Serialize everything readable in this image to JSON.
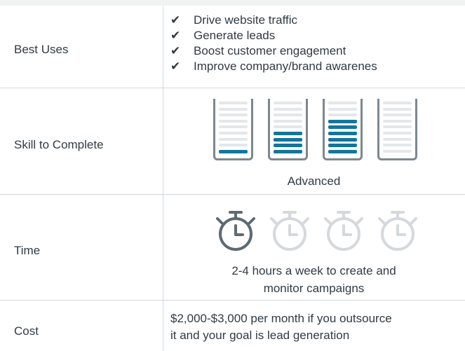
{
  "rows": {
    "best_uses": {
      "label": "Best Uses",
      "items": [
        "Drive website traffic",
        "Generate leads",
        "Boost customer engagement",
        "Improve company/brand awarenes"
      ]
    },
    "skill": {
      "label": "Skill to Complete",
      "level_text": "Advanced",
      "levels_filled": [
        1,
        4,
        6,
        0
      ],
      "bars_per_level": 9,
      "colors": {
        "filled": "#14759c",
        "empty": "#e4e7ea",
        "outline": "#7c8790"
      }
    },
    "time": {
      "label": "Time",
      "active_count": 1,
      "total": 4,
      "text_line1": "2-4 hours a week to create and",
      "text_line2": "monitor campaigns",
      "colors": {
        "active": "#5e6a73",
        "inactive": "#d5d9dc"
      }
    },
    "cost": {
      "label": "Cost",
      "text_line1": "$2,000-$3,000 per month if you outsource",
      "text_line2": "it and your goal is lead generation"
    }
  },
  "icons": {
    "check": "checkmark-icon",
    "watch": "stopwatch-icon",
    "cup": "level-cup-icon"
  }
}
